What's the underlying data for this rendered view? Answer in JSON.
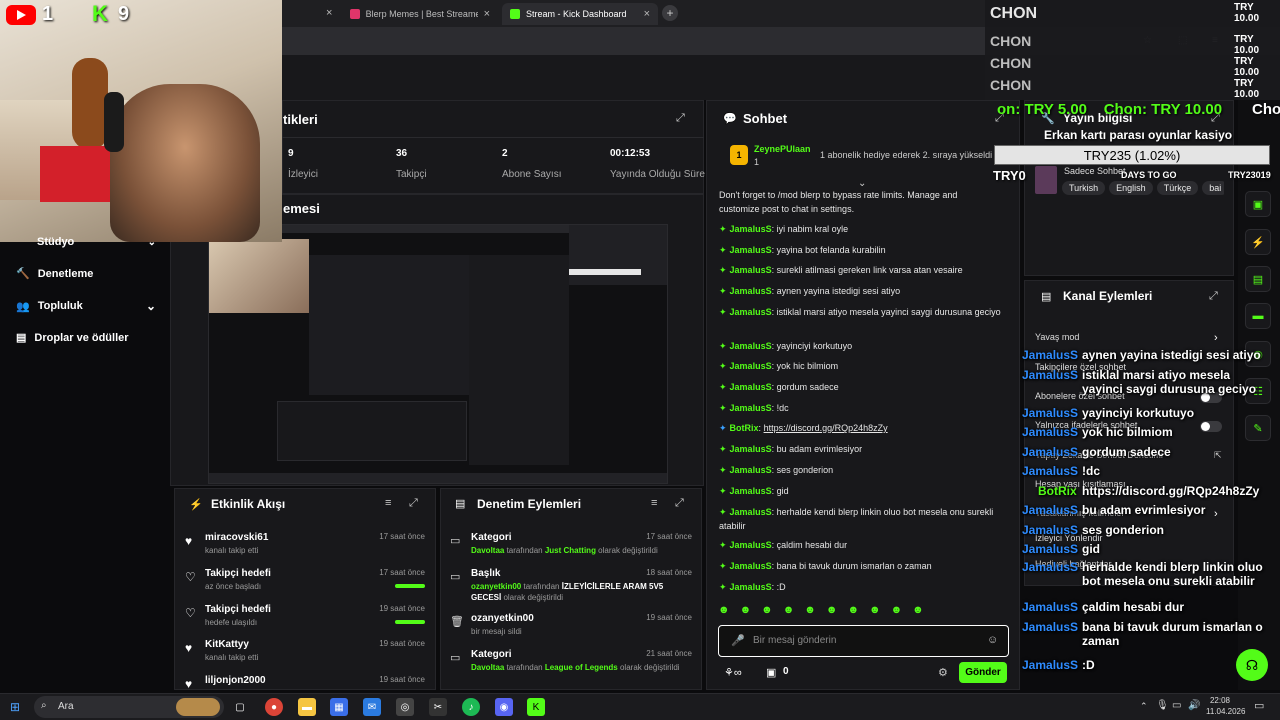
{
  "browser": {
    "tabs": [
      {
        "title": "Blerp Memes | Best Streamer S"
      },
      {
        "title": "Stream - Kick Dashboard"
      }
    ],
    "close_glyph": "×",
    "new_tab_glyph": "+"
  },
  "webcam": {
    "youtube_count": "1",
    "kick_count": "9"
  },
  "stats_panel": {
    "title_partial": "tikleri",
    "stats": [
      {
        "value": "9",
        "label": "İzleyici"
      },
      {
        "value": "36",
        "label": "Takipçi"
      },
      {
        "value": "2",
        "label": "Abone Sayısı"
      },
      {
        "value": "00:12:53",
        "label": "Yayında Olduğu Süre"
      }
    ]
  },
  "preview_panel": {
    "title_partial": "emesi"
  },
  "sidebar": {
    "items": [
      {
        "label": "Stüdyo",
        "icon": "chevron-down-icon"
      },
      {
        "label": "Denetleme",
        "icon": "hammer-icon"
      },
      {
        "label": "Topluluk",
        "icon": "users-icon"
      },
      {
        "label": "Droplar ve ödüller",
        "icon": "gift-icon"
      }
    ]
  },
  "activity": {
    "title": "Etkinlik Akışı",
    "items": [
      {
        "name": "miracovski61",
        "sub": "kanalı takip etti",
        "time": "17 saat önce",
        "icon": "heart-icon"
      },
      {
        "name": "Takipçi hedefi",
        "sub": "az önce başladı",
        "time": "17 saat önce",
        "icon": "heart-outline-icon",
        "progress": 0.9
      },
      {
        "name": "Takipçi hedefi",
        "sub": "hedefe ulaşıldı",
        "time": "19 saat önce",
        "icon": "heart-outline-icon",
        "progress": 1.0
      },
      {
        "name": "KitKattyy",
        "sub": "kanalı takip etti",
        "time": "19 saat önce",
        "icon": "heart-icon"
      },
      {
        "name": "liljonjon2000",
        "sub": "",
        "time": "19 saat önce",
        "icon": "heart-icon"
      }
    ]
  },
  "moderation": {
    "title": "Denetim Eylemleri",
    "items": [
      {
        "title": "Kategori",
        "user": "Davoltaa",
        "mid": " tarafından ",
        "value": "Just Chatting",
        "end": " olarak değiştirildi",
        "time": "17 saat önce"
      },
      {
        "title": "Başlık",
        "user": "ozanyetkin00",
        "mid": " tarafından ",
        "value": "İZLEYİCİLERLE ARAM 5V5 GECESİ",
        "end": " olarak değiştirildi",
        "time": "18 saat önce"
      },
      {
        "title": "ozanyetkin00",
        "user": "",
        "mid": "",
        "value": "",
        "end": "bir mesajı sildi",
        "time": "19 saat önce"
      },
      {
        "title": "Kategori",
        "user": "Davoltaa",
        "mid": " tarafından ",
        "value": "League of Legends",
        "end": " olarak değiştirildi",
        "time": "21 saat önce"
      }
    ]
  },
  "chat": {
    "title": "Sohbet",
    "pinned": {
      "user": "ZeynePUlaan",
      "count": "1",
      "text": "1 abonelik hediye ederek 2. sıraya yükseldi"
    },
    "intro": "Don't forget to /mod blerp to bypass rate limits. Manage and customize post to chat in settings.",
    "messages": [
      {
        "user": "JamalusS",
        "text": "iyi nabim kral oyle"
      },
      {
        "user": "JamalusS",
        "text": "yayina bot felanda kurabilin"
      },
      {
        "user": "JamalusS",
        "text": "surekli atilmasi gereken link varsa atan vesaire"
      },
      {
        "user": "JamalusS",
        "text": "aynen yayina istedigi sesi atiyo"
      },
      {
        "user": "JamalusS",
        "text": "istiklal marsi atiyo mesela yayinci saygi durusuna geciyo"
      },
      {
        "user": "JamalusS",
        "text": "yayinciyi korkutuyo"
      },
      {
        "user": "JamalusS",
        "text": "yok hic bilmiom"
      },
      {
        "user": "JamalusS",
        "text": "gordum sadece"
      },
      {
        "user": "JamalusS",
        "text": "!dc"
      },
      {
        "user": "BotRix",
        "text": "https://discord.gg/RQp24h8zZy"
      },
      {
        "user": "JamalusS",
        "text": "bu adam evrimlesiyor"
      },
      {
        "user": "JamalusS",
        "text": "ses gonderion"
      },
      {
        "user": "JamalusS",
        "text": "gid"
      },
      {
        "user": "JamalusS",
        "text": "herhalde kendi blerp linkin oluo bot mesela onu surekli atabilir"
      },
      {
        "user": "JamalusS",
        "text": "çaldim hesabi dur"
      },
      {
        "user": "JamalusS",
        "text": "bana bi tavuk durum ismarlan o zaman"
      },
      {
        "user": "JamalusS",
        "text": ":D"
      }
    ],
    "placeholder": "Bir mesaj gönderin",
    "count": "0",
    "send": "Gönder"
  },
  "stream_info": {
    "title": "Yayın bilgisi",
    "stream_title": "Erkan kartı parası oyunlar kasiyo",
    "tags": [
      "Turkish",
      "English",
      "Türkçe",
      "bai"
    ],
    "subtitle": "Sadece Sohbet"
  },
  "channel_actions": {
    "title": "Kanal Eylemleri",
    "rows": [
      "Yavaş mod",
      "Takipçilere özel sohbet",
      "Abonelere özel sohbet",
      "Yalnızca ifadelerle sohbet",
      "Yapay Zeka ile Sohbet Denetimi",
      "Hesap yaşı kısıtlaması",
      "Yasaklanmış kelimeler",
      "İzleyici Yönlendir",
      "Hediyeli bağlantılar"
    ]
  },
  "overlay": {
    "chon_lines": [
      "CHON",
      "CHON",
      "CHON",
      "CHON"
    ],
    "try_top": "TRY 10.00",
    "ticker": "on: TRY 5.00    Chon: TRY 10.00",
    "ticker_tail": "Cho",
    "goal": "TRY235 (1.02%)",
    "left_amt": "TRY0",
    "right_amt": "TRY23019",
    "goal_label": "DAYS TO GO",
    "chat_lines": [
      {
        "user": "JamalusS",
        "text": "aynen yayina istedigi sesi atiyo"
      },
      {
        "user": "JamalusS",
        "text": "istiklal marsi atiyo mesela yayinci saygi durusuna geciyo"
      },
      {
        "user": "JamalusS",
        "text": "yayinciyi korkutuyo"
      },
      {
        "user": "JamalusS",
        "text": "yok hic bilmiom"
      },
      {
        "user": "JamalusS",
        "text": "gordum sadece"
      },
      {
        "user": "JamalusS",
        "text": "!dc"
      },
      {
        "user": "BotRix",
        "text": "https://discord.gg/RQp24h8zZy"
      },
      {
        "user": "JamalusS",
        "text": "bu adam evrimlesiyor"
      },
      {
        "user": "JamalusS",
        "text": "ses gonderion"
      },
      {
        "user": "JamalusS",
        "text": "gid"
      },
      {
        "user": "JamalusS",
        "text": "herhalde kendi blerp linkin oluo bot mesela onu surekli atabilir"
      },
      {
        "user": "JamalusS",
        "text": "çaldim hesabi dur"
      },
      {
        "user": "JamalusS",
        "text": "bana bi tavuk durum ismarlan o zaman"
      },
      {
        "user": "JamalusS",
        "text": ":D"
      }
    ]
  },
  "taskbar": {
    "search": "Ara",
    "time": "22:08",
    "date": "11.04.2026"
  },
  "colors": {
    "accent": "#53fc18",
    "panel": "#18181b",
    "overlay_user": "#2f8cff"
  }
}
